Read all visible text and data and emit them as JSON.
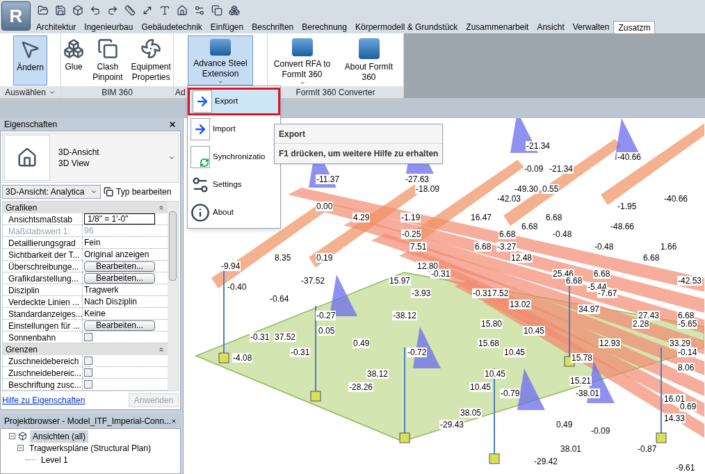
{
  "app_button": {
    "label": "R"
  },
  "tabs": [
    {
      "label": "Architektur",
      "selected": false
    },
    {
      "label": "Ingenieurbau",
      "selected": false
    },
    {
      "label": "Gebäudetechnik",
      "selected": false
    },
    {
      "label": "Einfügen",
      "selected": false
    },
    {
      "label": "Beschriften",
      "selected": false
    },
    {
      "label": "Berechnung",
      "selected": false
    },
    {
      "label": "Körpermodell & Grundstück",
      "selected": false
    },
    {
      "label": "Zusammenarbeit",
      "selected": false
    },
    {
      "label": "Ansicht",
      "selected": false
    },
    {
      "label": "Verwalten",
      "selected": false
    },
    {
      "label": "Zusatzm",
      "selected": true
    }
  ],
  "ribbon": {
    "panels": [
      {
        "title": "Auswählen",
        "dropdown": true,
        "buttons": [
          {
            "label": "Ändern",
            "selected": true,
            "dropdown": false
          }
        ]
      },
      {
        "title": "BIM 360",
        "dropdown": false,
        "buttons": [
          {
            "label": "Glue",
            "selected": false,
            "dropdown": false
          },
          {
            "label": "Clash Pinpoint",
            "selected": false,
            "dropdown": false
          },
          {
            "label": "Equipment Properties",
            "selected": false,
            "dropdown": false
          }
        ]
      },
      {
        "title": "Ad",
        "dropdown": false,
        "buttons": [
          {
            "label": "Advance Steel Extension",
            "selected": true,
            "dropdown": true
          }
        ]
      },
      {
        "title": "FormIt 360 Converter",
        "dropdown": false,
        "buttons": [
          {
            "label": "Convert RFA to FormIt 360",
            "selected": false,
            "dropdown": true
          },
          {
            "label": "About FormIt 360",
            "selected": false,
            "dropdown": false
          }
        ]
      }
    ]
  },
  "menu": {
    "items": [
      {
        "label": "Export",
        "selected": true
      },
      {
        "label": "Import",
        "selected": false
      },
      {
        "label": "Synchronizatio",
        "selected": false
      },
      {
        "label": "Settings",
        "selected": false
      },
      {
        "label": "About",
        "selected": false
      }
    ]
  },
  "tooltip": {
    "title": "Export",
    "body": "F1 drücken, um weitere Hilfe zu erhalten"
  },
  "properties": {
    "title": "Eigenschaften",
    "type_name": "3D-Ansicht",
    "type_sub": "3D View",
    "view_select": "3D-Ansicht: Analytica",
    "edit_type": "Typ bearbeiten",
    "groups": [
      {
        "name": "Grafiken",
        "rows": [
          {
            "kind": "input",
            "label": "Ansichtsmaßstab",
            "value": "1/8\" = 1'-0\"",
            "disabled": false
          },
          {
            "kind": "text",
            "label": "Maßstabswert 1:",
            "value": "96",
            "disabled": true
          },
          {
            "kind": "text",
            "label": "Detaillierungsgrad",
            "value": "Fein",
            "disabled": false
          },
          {
            "kind": "text",
            "label": "Sichtbarkeit der T...",
            "value": "Original anzeigen",
            "disabled": false
          },
          {
            "kind": "button",
            "label": "Überschreibunge...",
            "value": "Bearbeiten...",
            "disabled": false
          },
          {
            "kind": "button",
            "label": "Grafikdarstellung...",
            "value": "Bearbeiten...",
            "disabled": false
          },
          {
            "kind": "text",
            "label": "Disziplin",
            "value": "Tragwerk",
            "disabled": false
          },
          {
            "kind": "text",
            "label": "Verdeckte Linien ...",
            "value": "Nach Disziplin",
            "disabled": false
          },
          {
            "kind": "text",
            "label": "Standardanzeiges...",
            "value": "Keine",
            "disabled": false
          },
          {
            "kind": "button",
            "label": "Einstellungen für ...",
            "value": "Bearbeiten...",
            "disabled": false
          },
          {
            "kind": "checkbox",
            "label": "Sonnenbahn",
            "checked": false,
            "disabled": false
          }
        ]
      },
      {
        "name": "Grenzen",
        "rows": [
          {
            "kind": "checkbox",
            "label": "Zuschneidebereich",
            "checked": false,
            "disabled": false
          },
          {
            "kind": "checkbox",
            "label": "Zuschneidebereic...",
            "checked": false,
            "disabled": false
          },
          {
            "kind": "checkbox",
            "label": "Beschriftung zusc...",
            "checked": false,
            "disabled": false
          }
        ]
      }
    ],
    "help_link": "Hilfe zu Eigenschaften",
    "apply": {
      "label": "Anwenden",
      "disabled": true
    }
  },
  "browser": {
    "title": "Projektbrowser - Model_ITF_Imperial-Conn...",
    "tree": [
      {
        "label": "Ansichten (all)",
        "selected": true,
        "expanded": true,
        "children": [
          {
            "label": "Tragwerkspläne (Structural Plan)",
            "selected": false,
            "expanded": true,
            "children": [
              {
                "label": "Level 1",
                "selected": false
              }
            ]
          }
        ]
      }
    ]
  },
  "viewport": {
    "labels": [
      "-21.34",
      "-40.66",
      "-0.09",
      "-21.34",
      "-11.37",
      "-27.63",
      "-18.09",
      "-49.30",
      "0.55",
      "-42.03",
      "-40.66",
      "0.00",
      "-1.95",
      "4.29",
      "-1.19",
      "16.47",
      "6.68",
      "6.68",
      "-48.66",
      "-0.25",
      "6.68",
      "-0.48",
      "7.51",
      "6.68",
      "-3.27",
      "-0.48",
      "1.66",
      "8.35",
      "0.19",
      "12.48",
      "6.68",
      "-9.94",
      "12.80",
      "-0.31",
      "25.46",
      "6.68",
      "-37.52",
      "15.97",
      "6.68",
      "-42.53",
      "-0.40",
      "-5.44",
      "-3.93",
      "-0.31",
      "7.52",
      "-7.67",
      "-0.64",
      "13.02",
      "34.97",
      "-0.27",
      "-38.12",
      "27.43",
      "6.68",
      "15.80",
      "2.28",
      "-5.65",
      "0.05",
      "10.45",
      "-0.31",
      "37.52",
      "0.49",
      "15.68",
      "12.93",
      "33.29",
      "-0.31",
      "-0.72",
      "10.45",
      "-0.14",
      "-4.08",
      "15.78",
      "8.06",
      "38.12",
      "10.45",
      "15.21",
      "-28.26",
      "10.45",
      "-0.79",
      "-38.01",
      "16.01",
      "0.69",
      "38.05",
      "14.33",
      "-29.43",
      "0.49",
      "-0.09",
      "38.01",
      "-0.87",
      "-29.42",
      "-9.61"
    ]
  }
}
